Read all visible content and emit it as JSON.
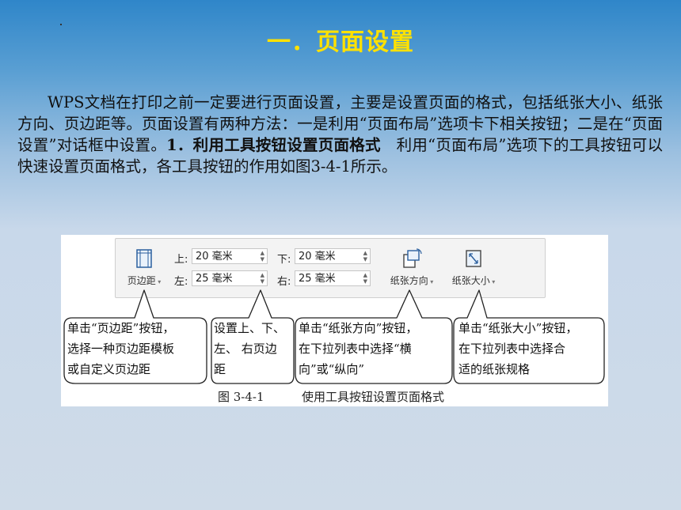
{
  "title": "一．页面设置",
  "paragraph": {
    "part1": "WPS文档在打印之前一定要进行页面设置，主要是设置页面的格式，包括纸张大小、纸张方向、页边距等。页面设置有两种方法：一是利用“页面布局”选项卡下相关按钮；二是在“页面设置”对话框中设置。",
    "bold": "1．利用工具按钮设置页面格式",
    "part2": "　利用“页面布局”选项下的工具按钮可以快速设置页面格式，各工具按钮的作用如图3-4-1所示。"
  },
  "ribbon": {
    "margins_button": "页边距",
    "top_label": "上:",
    "top_value": "20 毫米",
    "bottom_label": "下:",
    "bottom_value": "20 毫米",
    "left_label": "左:",
    "left_value": "25 毫米",
    "right_label": "右:",
    "right_value": "25 毫米",
    "orientation_button": "纸张方向",
    "size_button": "纸张大小"
  },
  "callouts": {
    "c1": [
      "单击“页边距”按钮，",
      "选择一种页边距模板",
      "或自定义页边距"
    ],
    "c2": [
      "设置上、下、",
      "左、 右页边",
      "距"
    ],
    "c3": [
      "单击“纸张方向”按钮，",
      "在下拉列表中选择“横",
      "向”或“纵向”"
    ],
    "c4": [
      "单击“纸张大小”按钮，",
      "在下拉列表中选择合",
      "适的纸张规格"
    ]
  },
  "caption": {
    "number": "图 3-4-1",
    "text": "使用工具按钮设置页面格式"
  }
}
